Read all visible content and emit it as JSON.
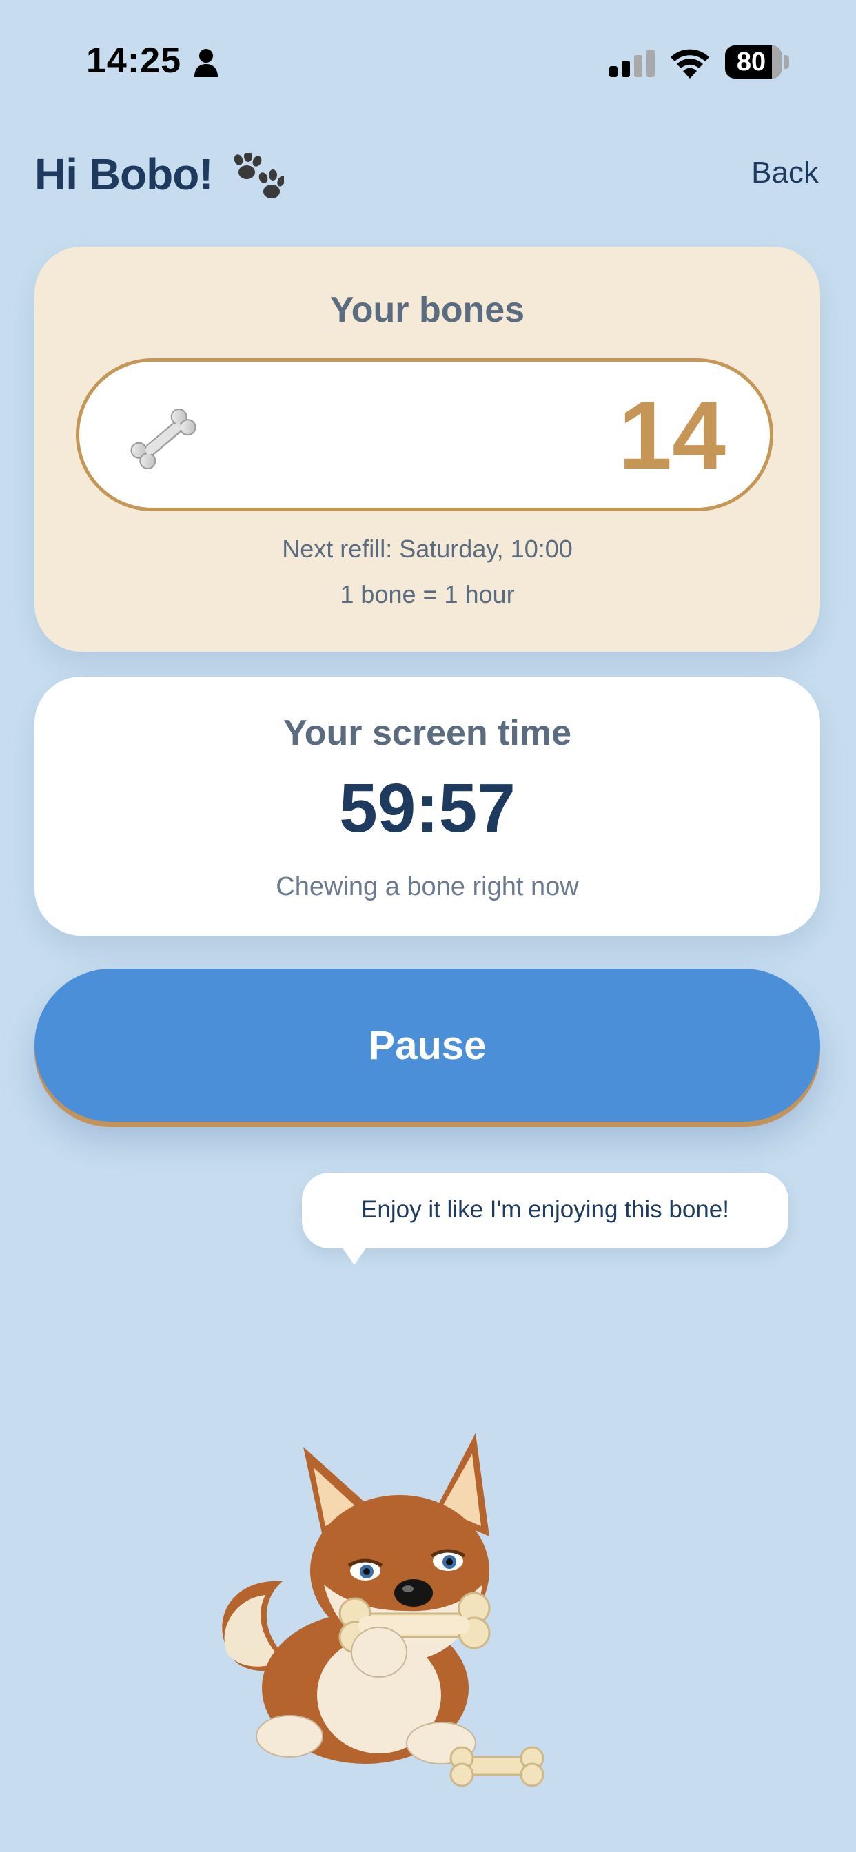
{
  "status_bar": {
    "time": "14:25",
    "battery_level": "80",
    "icons": [
      "person-icon",
      "signal-icon",
      "wifi-icon",
      "battery-icon"
    ]
  },
  "header": {
    "greeting": "Hi Bobo!",
    "back_label": "Back",
    "icons": [
      "paw-icon"
    ]
  },
  "bones_card": {
    "title": "Your bones",
    "count": "14",
    "refill": "Next refill: Saturday, 10:00",
    "rate": "1 bone = 1 hour",
    "icon": "bone-icon"
  },
  "screen_time_card": {
    "title": "Your screen time",
    "timer": "59:57",
    "status": "Chewing a bone right now"
  },
  "actions": {
    "pause_label": "Pause"
  },
  "bubble": {
    "text": "Enjoy it like I'm enjoying this bone!"
  },
  "mascot": {
    "icon": "dog-with-bone-illustration"
  },
  "colors": {
    "background": "#c7ddef",
    "primary_text": "#1e3a5f",
    "accent_gold": "#c69656",
    "bones_card_bg": "#f4ead7",
    "button_blue": "#4b8fd9"
  }
}
